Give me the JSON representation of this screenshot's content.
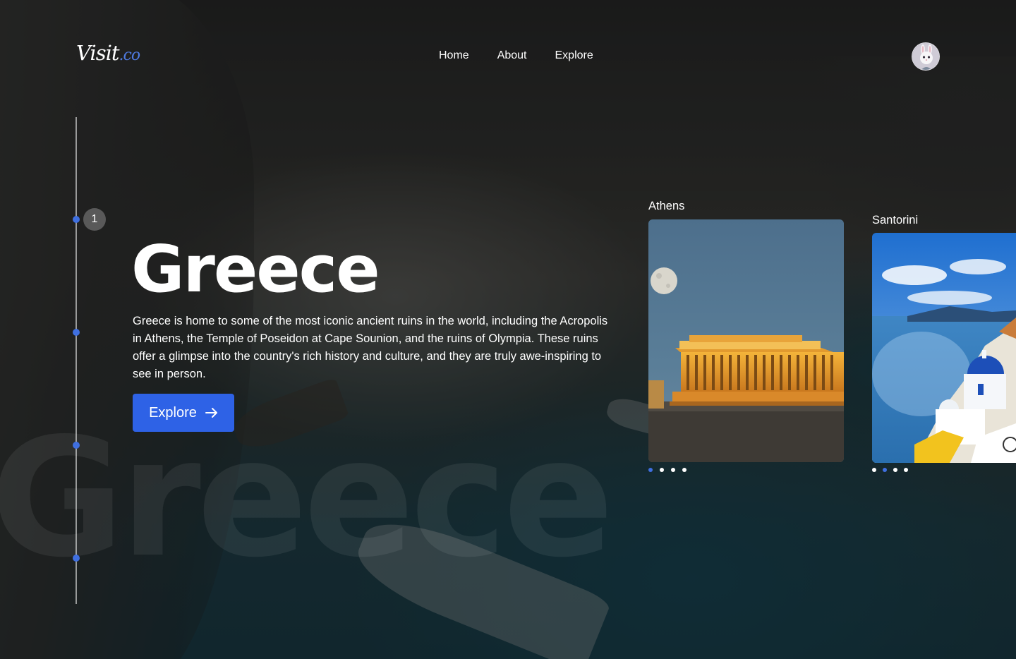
{
  "brand": {
    "name": "Visit",
    "suffix": ".co"
  },
  "nav": {
    "items": [
      "Home",
      "About",
      "Explore"
    ]
  },
  "timeline": {
    "current_step": "1"
  },
  "hero": {
    "title": "Greece",
    "watermark": "Greece",
    "description": "Greece is home to some of the most iconic ancient ruins in the world, including the Acropolis in Athens, the Temple of Poseidon at Cape Sounion, and the ruins of Olympia. These ruins offer a glimpse into the country's rich history and culture, and they are truly awe-inspiring to see in person.",
    "button_label": "Explore"
  },
  "cards": [
    {
      "label": "Athens",
      "image": "acropolis-parthenon-night",
      "active_dot": 1,
      "dot_count": 4
    },
    {
      "label": "Santorini",
      "image": "santorini-blue-dome",
      "active_dot": 2,
      "dot_count": 4
    }
  ],
  "colors": {
    "accent": "#2e62e6",
    "dot_active": "#3f6fe0"
  }
}
